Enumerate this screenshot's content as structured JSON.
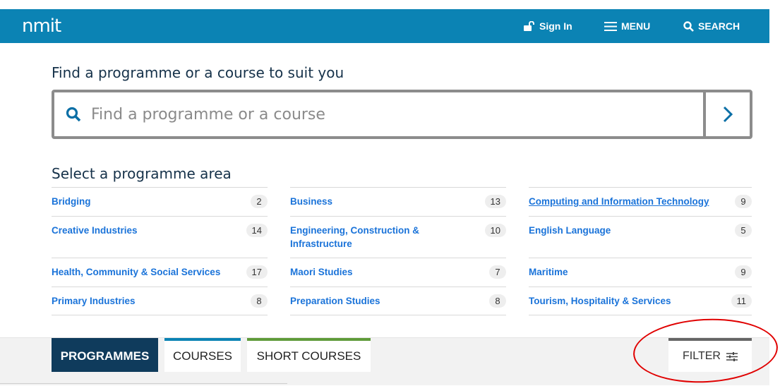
{
  "header": {
    "logo": "nmit",
    "sign_in": "Sign In",
    "menu": "MENU",
    "search": "SEARCH"
  },
  "search": {
    "heading": "Find a programme or a course to suit you",
    "placeholder": "Find a programme or a course"
  },
  "areas": {
    "heading": "Select a programme area",
    "items": [
      {
        "label": "Bridging",
        "count": "2"
      },
      {
        "label": "Business",
        "count": "13"
      },
      {
        "label": "Computing and Information Technology",
        "count": "9"
      },
      {
        "label": "Creative Industries",
        "count": "14"
      },
      {
        "label": "Engineering, Construction & Infrastructure",
        "count": "10"
      },
      {
        "label": "English Language",
        "count": "5"
      },
      {
        "label": "Health, Community & Social Services",
        "count": "17"
      },
      {
        "label": "Maori Studies",
        "count": "7"
      },
      {
        "label": "Maritime",
        "count": "9"
      },
      {
        "label": "Primary Industries",
        "count": "8"
      },
      {
        "label": "Preparation Studies",
        "count": "8"
      },
      {
        "label": "Tourism, Hospitality & Services",
        "count": "11"
      }
    ]
  },
  "tabs": {
    "programmes": "PROGRAMMES",
    "courses": "COURSES",
    "short_courses": "SHORT COURSES",
    "filter": "FILTER"
  },
  "colors": {
    "header_bg": "#0b83b4",
    "link": "#1a73d9",
    "active_tab": "#0f3b5c",
    "courses_accent": "#0b83b4",
    "short_courses_accent": "#5f9b3a",
    "annotation": "#e00000"
  }
}
